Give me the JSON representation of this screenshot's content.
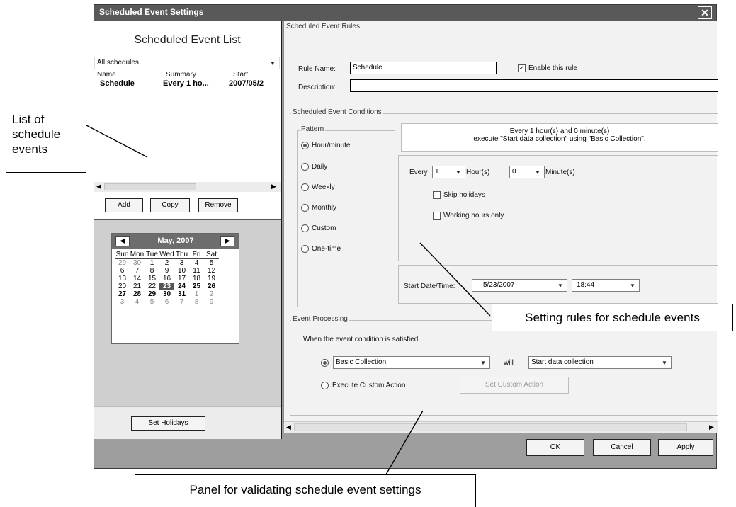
{
  "window": {
    "title": "Scheduled Event Settings",
    "close_glyph": "✕"
  },
  "left": {
    "header": "Scheduled Event List",
    "filter": "All schedules",
    "columns": [
      "Name",
      "Summary",
      "Start"
    ],
    "rows": [
      {
        "name": "Schedule",
        "summary": "Every 1 ho...",
        "start": "2007/05/2"
      }
    ],
    "buttons": {
      "add": "Add",
      "copy": "Copy",
      "remove": "Remove"
    },
    "calendar": {
      "month": "May, 2007",
      "weekdays": [
        "Sun",
        "Mon",
        "Tue",
        "Wed",
        "Thu",
        "Fri",
        "Sat"
      ],
      "weeks": [
        [
          "29",
          "30",
          "1",
          "2",
          "3",
          "4",
          "5"
        ],
        [
          "6",
          "7",
          "8",
          "9",
          "10",
          "11",
          "12"
        ],
        [
          "13",
          "14",
          "15",
          "16",
          "17",
          "18",
          "19"
        ],
        [
          "20",
          "21",
          "22",
          "23",
          "24",
          "25",
          "26"
        ],
        [
          "27",
          "28",
          "29",
          "30",
          "31",
          "1",
          "2"
        ],
        [
          "3",
          "4",
          "5",
          "6",
          "7",
          "8",
          "9"
        ]
      ],
      "selected": "23"
    },
    "set_holidays": "Set Holidays"
  },
  "rules": {
    "section": "Scheduled Event Rules",
    "rule_name_label": "Rule Name:",
    "rule_name_value": "Schedule",
    "enable_label": "Enable this rule",
    "description_label": "Description:",
    "description_value": ""
  },
  "conditions": {
    "section": "Scheduled Event Conditions",
    "pattern_label": "Pattern",
    "patterns": [
      "Hour/minute",
      "Daily",
      "Weekly",
      "Monthly",
      "Custom",
      "One-time"
    ],
    "summary_line1": "Every 1 hour(s) and 0 minute(s)",
    "summary_line2": "execute \"Start data collection\" using \"Basic Collection\".",
    "every_label": "Every",
    "hours_value": "1",
    "hours_label": "Hour(s)",
    "minutes_value": "0",
    "minutes_label": "Minute(s)",
    "skip_holidays": "Skip holidays",
    "working_hours": "Working hours only",
    "start_label": "Start Date/Time:",
    "start_date": "5/23/2007",
    "start_time": "18:44"
  },
  "processing": {
    "section": "Event Processing",
    "when_label": "When the event condition is satisfied",
    "collection": "Basic Collection",
    "will": "will",
    "action": "Start data collection",
    "custom_label": "Execute Custom Action",
    "set_custom": "Set Custom Action"
  },
  "footer": {
    "ok": "OK",
    "cancel": "Cancel",
    "apply": "Apply"
  },
  "callouts": {
    "list": "List of schedule events",
    "rules": "Setting rules for schedule events",
    "panel": "Panel for validating schedule event settings"
  }
}
